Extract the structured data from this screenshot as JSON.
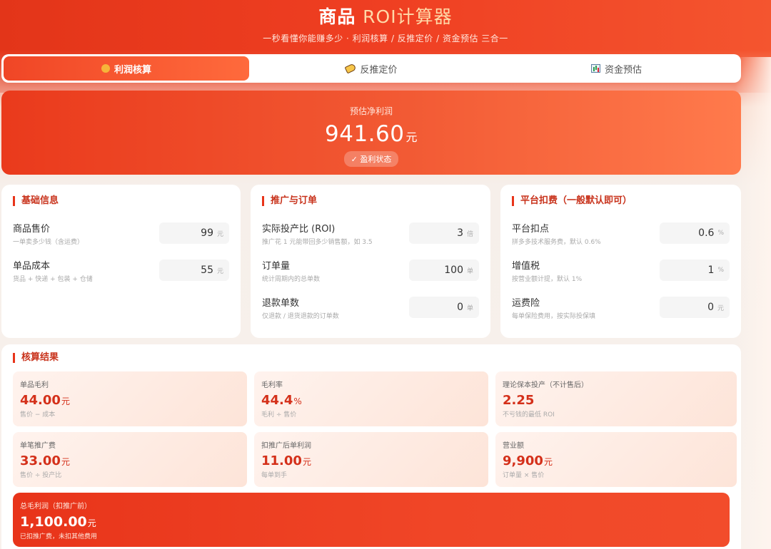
{
  "header": {
    "title_main": "商品",
    "title_accent": "ROI计算器",
    "subtitle": "一秒看懂你能赚多少 · 利润核算 / 反推定价 / 资金预估 三合一"
  },
  "tabs": [
    {
      "label": "利润核算",
      "icon": "money-bag-icon",
      "active": true
    },
    {
      "label": "反推定价",
      "icon": "price-tag-icon",
      "active": false
    },
    {
      "label": "资金预估",
      "icon": "bar-chart-icon",
      "active": false
    }
  ],
  "hero": {
    "label": "预估净利润",
    "value": "941.60",
    "unit": "元",
    "badge": "✓ 盈利状态"
  },
  "basic": {
    "title": "基础信息",
    "fields": [
      {
        "label": "商品售价",
        "hint": "一单卖多少钱（含运费）",
        "value": "99",
        "unit": "元"
      },
      {
        "label": "单品成本",
        "hint": "货品 + 快递 + 包装 + 仓储",
        "value": "55",
        "unit": "元"
      }
    ]
  },
  "promo": {
    "title": "推广与订单",
    "fields": [
      {
        "label": "实际投产比 (ROI)",
        "hint": "推广花 1 元能带回多少销售额，如 3.5",
        "value": "3",
        "unit": "倍"
      },
      {
        "label": "订单量",
        "hint": "统计周期内的总单数",
        "value": "100",
        "unit": "单"
      },
      {
        "label": "退款单数",
        "hint": "仅退款 / 退货退款的订单数",
        "value": "0",
        "unit": "单"
      }
    ]
  },
  "platform": {
    "title": "平台扣费（一般默认即可）",
    "fields": [
      {
        "label": "平台扣点",
        "hint": "拼多多技术服务费，默认 0.6%",
        "value": "0.6",
        "unit": "%"
      },
      {
        "label": "增值税",
        "hint": "按营业额计提，默认 1%",
        "value": "1",
        "unit": "%"
      },
      {
        "label": "运费险",
        "hint": "每单保险费用，按实际投保填",
        "value": "0",
        "unit": "元"
      }
    ]
  },
  "results": {
    "title": "核算结果",
    "cards": [
      {
        "label": "单品毛利",
        "value": "44.00",
        "unit": "元",
        "hint": "售价 − 成本"
      },
      {
        "label": "毛利率",
        "value": "44.4",
        "unit": "%",
        "hint": "毛利 ÷ 售价"
      },
      {
        "label": "理论保本投产（不计售后）",
        "value": "2.25",
        "unit": "",
        "hint": "不亏钱的最低 ROI"
      },
      {
        "label": "单笔推广费",
        "value": "33.00",
        "unit": "元",
        "hint": "售价 ÷ 投产比"
      },
      {
        "label": "扣推广后单利润",
        "value": "11.00",
        "unit": "元",
        "hint": "每单到手"
      },
      {
        "label": "营业额",
        "value": "9,900",
        "unit": "元",
        "hint": "订单量 × 售价"
      }
    ],
    "total": {
      "label": "总毛利润（扣推广前）",
      "value": "1,100.00",
      "unit": "元",
      "hint": "已扣推广费，未扣其他费用"
    }
  },
  "colors": {
    "accent": "#e8341a",
    "accent_light": "#ff6a3c",
    "value_red": "#d4301a"
  }
}
